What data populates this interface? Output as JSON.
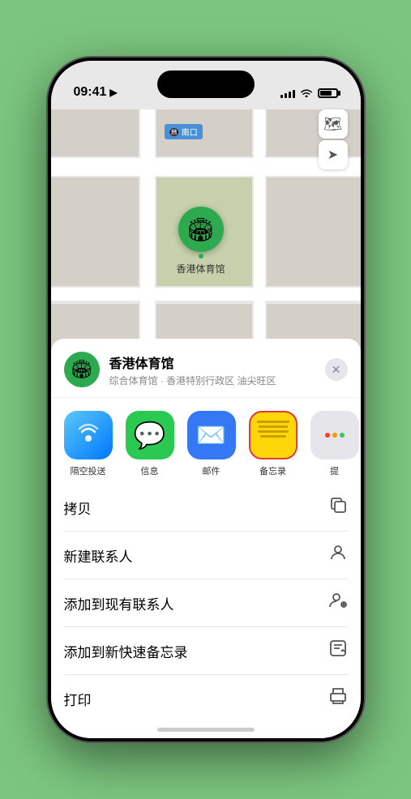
{
  "status_bar": {
    "time": "09:41",
    "location_arrow": "▶"
  },
  "map": {
    "location_label": "🚇 南口",
    "controls": {
      "map_toggle": "🗺",
      "location": "➤"
    },
    "venue_name_on_map": "香港体育馆"
  },
  "share_sheet": {
    "venue": {
      "name": "香港体育馆",
      "description": "综合体育馆 · 香港特别行政区 油尖旺区"
    },
    "close_label": "✕",
    "apps": [
      {
        "id": "airdrop",
        "label": "隔空投送",
        "icon": "📡"
      },
      {
        "id": "messages",
        "label": "信息",
        "icon": "💬"
      },
      {
        "id": "mail",
        "label": "邮件",
        "icon": "✉️"
      },
      {
        "id": "notes",
        "label": "备忘录",
        "icon": "📝"
      },
      {
        "id": "more",
        "label": "提",
        "icon": "···"
      }
    ],
    "actions": [
      {
        "id": "copy",
        "label": "拷贝",
        "icon": "⧉"
      },
      {
        "id": "new-contact",
        "label": "新建联系人",
        "icon": "👤"
      },
      {
        "id": "add-existing",
        "label": "添加到现有联系人",
        "icon": "👤"
      },
      {
        "id": "quick-note",
        "label": "添加到新快速备忘录",
        "icon": "🖊"
      },
      {
        "id": "print",
        "label": "打印",
        "icon": "🖨"
      }
    ]
  }
}
